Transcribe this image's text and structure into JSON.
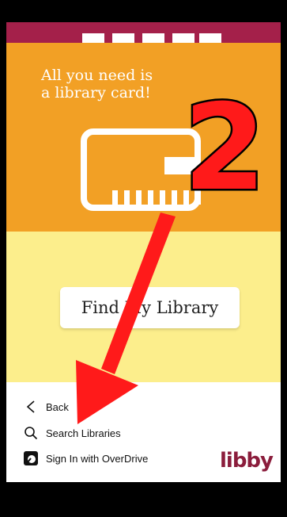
{
  "onboarding": {
    "headline_line1": "All you need is",
    "headline_line2": "a library card!",
    "find_button_label": "Find My Library"
  },
  "bottom_menu": {
    "back_label": "Back",
    "search_label": "Search Libraries",
    "overdrive_label": "Sign In with OverDrive",
    "brand": "libby"
  },
  "annotation": {
    "step_number": "2",
    "arrow_color": "#ff1a1a"
  },
  "colors": {
    "maroon": "#a4204a",
    "orange": "#f2a025",
    "yellow": "#fcee8c",
    "brand": "#8b1d3c"
  }
}
